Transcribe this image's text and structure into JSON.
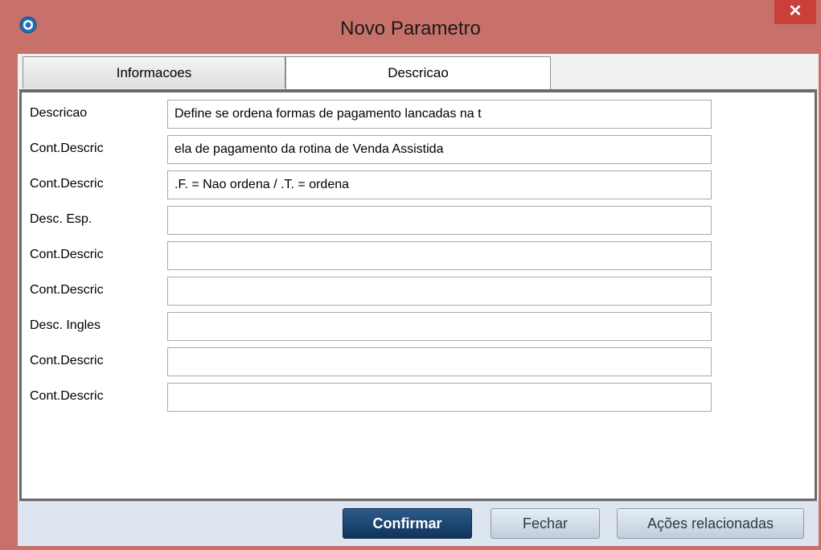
{
  "window": {
    "title": "Novo Parametro",
    "close_label": "✕"
  },
  "tabs": [
    {
      "label": "Informacoes",
      "active": false
    },
    {
      "label": "Descricao",
      "active": true
    }
  ],
  "fields": [
    {
      "label": "Descricao",
      "value": "Define se ordena formas de pagamento lancadas na t"
    },
    {
      "label": "Cont.Descric",
      "value": "ela de pagamento da rotina de Venda Assistida"
    },
    {
      "label": "Cont.Descric",
      "value": ".F. = Nao ordena / .T. = ordena"
    },
    {
      "label": "Desc. Esp.",
      "value": ""
    },
    {
      "label": "Cont.Descric",
      "value": ""
    },
    {
      "label": "Cont.Descric",
      "value": ""
    },
    {
      "label": "Desc. Ingles",
      "value": ""
    },
    {
      "label": "Cont.Descric",
      "value": ""
    },
    {
      "label": "Cont.Descric",
      "value": ""
    }
  ],
  "buttons": {
    "confirm": "Confirmar",
    "close": "Fechar",
    "actions": "Ações relacionadas"
  },
  "colors": {
    "titlebar": "#c8716a",
    "close_button": "#c9403a",
    "confirm_button": "#1e4a78"
  }
}
